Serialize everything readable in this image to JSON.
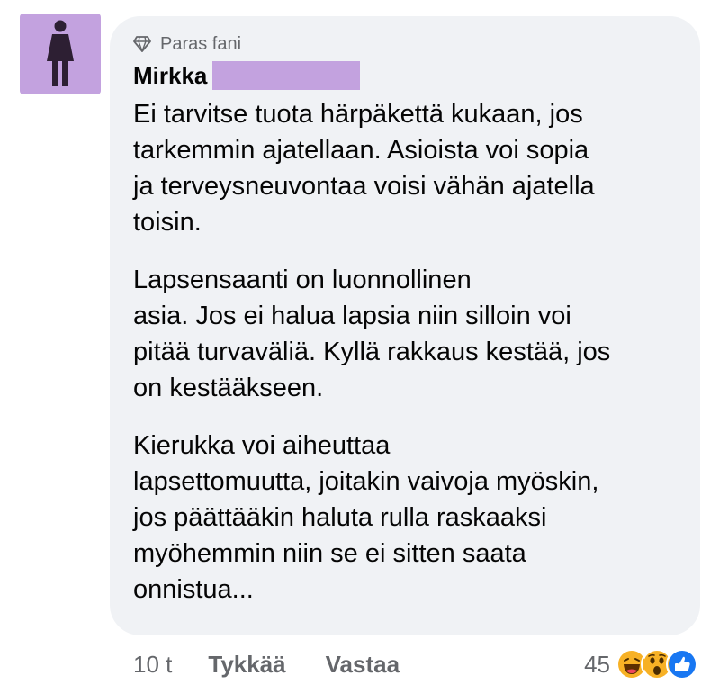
{
  "comment": {
    "badge": "Paras fani",
    "badge_icon": "diamond-icon",
    "author": "Mirkka",
    "paragraphs": [
      {
        "lines": [
          "Ei tarvitse tuota härpäkettä kukaan, jos",
          "tarkemmin ajatellaan. Asioista voi sopia",
          "ja terveysneuvontaa voisi vähän ajatella",
          "toisin."
        ]
      },
      {
        "lines": [
          "Lapsensaanti on luonnollinen",
          "asia. Jos ei halua lapsia niin silloin voi",
          "pitää turvaväliä. Kyllä rakkaus kestää, jos",
          "on kestääkseen."
        ]
      },
      {
        "lines": [
          "Kierukka voi aiheuttaa",
          "lapsettomuutta, joitakin vaivoja myöskin,",
          "jos päättääkin haluta rulla raskaaksi",
          "myöhemmin niin se ei sitten saata",
          "onnistua..."
        ]
      }
    ]
  },
  "actions": {
    "time": "10 t",
    "like": "Tykkää",
    "reply": "Vastaa"
  },
  "reactions": {
    "count": "45",
    "icons": [
      "laughing-emoji-icon",
      "wow-emoji-icon",
      "like-thumb-icon"
    ]
  },
  "colors": {
    "avatar_bg": "#c3a2df",
    "redaction": "#c3a2df",
    "bubble_bg": "#f0f2f5",
    "meta_text": "#65676b",
    "like_blue": "#1877f2"
  }
}
